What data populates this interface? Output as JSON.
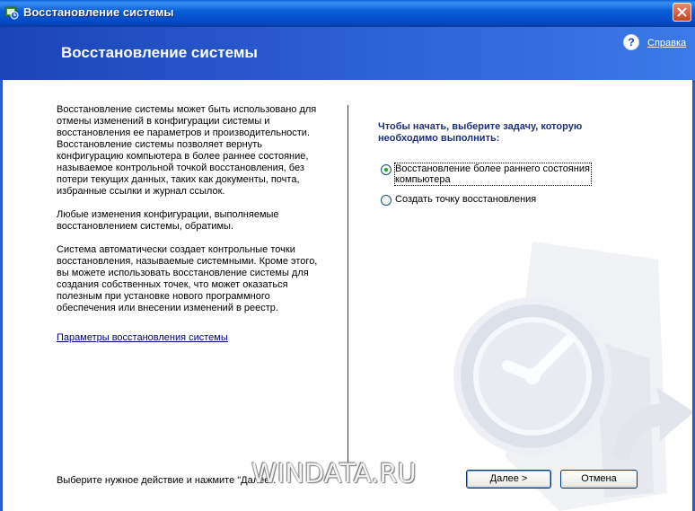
{
  "window": {
    "title": "Восстановление системы",
    "icons": {
      "app": "system-restore-icon",
      "close": "close-icon"
    }
  },
  "header": {
    "title": "Восстановление системы",
    "help_icon": "help-icon",
    "help_label": "Справка"
  },
  "left": {
    "paragraphs": [
      "Восстановление системы может быть использовано для отмены изменений в конфигурации системы и восстановления ее параметров и производительности. Восстановление системы позволяет вернуть конфигурацию компьютера в более раннее состояние, называемое контрольной точкой восстановления, без потери текущих данных, таких как документы, почта, избранные ссылки и журнал ссылок.",
      "Любые изменения конфигурации, выполняемые восстановлением системы, обратимы.",
      "Система автоматически создает контрольные точки восстановления, называемые системными. Кроме этого, вы можете использовать восстановление системы для создания собственных точек, что может оказаться полезным при установке нового программного обеспечения или внесении изменений в реестр."
    ],
    "settings_link": "Параметры восстановления системы"
  },
  "right": {
    "prompt": "Чтобы начать, выберите задачу, которую необходимо выполнить:",
    "options": [
      {
        "label": "Восстановление более раннего состояния компьютера",
        "checked": true
      },
      {
        "label": "Создать точку восстановления",
        "checked": false
      }
    ],
    "background_art": "clock-restore-icon"
  },
  "footer": {
    "instruction": "Выберите нужное действие и нажмите \"Далее\".",
    "next_prefix": "Д",
    "next_rest": "алее >",
    "cancel_label": "Отмена"
  },
  "watermark": "WINDATA.RU",
  "colors": {
    "title_bar": "#0a5fd8",
    "header_left": "#1c44b8",
    "header_right": "#3b7ae8",
    "divider": "#1c3b8f",
    "prompt_text": "#1c2f7a",
    "link_text": "#000080",
    "radio_dot": "#21a121"
  }
}
